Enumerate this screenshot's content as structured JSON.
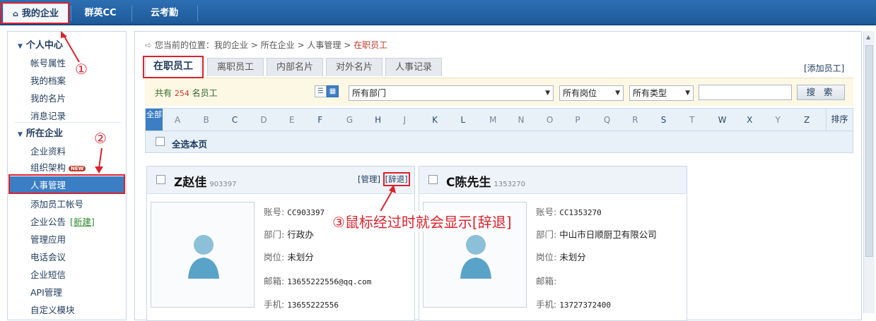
{
  "topnav": {
    "tabs": [
      "我的企业",
      "群英CC",
      "云考勤"
    ]
  },
  "sidebar": {
    "sections": [
      {
        "title": "个人中心",
        "items": [
          "帐号属性",
          "我的档案",
          "我的名片",
          "消息记录"
        ]
      },
      {
        "title": "所在企业",
        "items": [
          "企业资料",
          "组织架构",
          "人事管理",
          "添加员工帐号",
          "企业公告",
          "管理应用",
          "电话会议",
          "企业短信",
          "API管理",
          "自定义模块"
        ]
      }
    ],
    "new_badge": "NEW",
    "new_link": "[新建]"
  },
  "breadcrumb": {
    "prefix": "您当前的位置：",
    "items": [
      "我的企业",
      "所在企业",
      "人事管理"
    ],
    "current": "在职员工",
    "sep": ">"
  },
  "subtabs": [
    "在职员工",
    "离职员工",
    "内部名片",
    "对外名片",
    "人事记录"
  ],
  "add_employee": "[添加员工]",
  "filters": {
    "count_prefix": "共有",
    "count": "254",
    "count_suffix": "名员工",
    "department": "所有部门",
    "position": "所有岗位",
    "type": "所有类型",
    "search_value": "",
    "search_button": "搜 索"
  },
  "alphabet": {
    "all": "全部",
    "letters": [
      "A",
      "B",
      "C",
      "D",
      "E",
      "F",
      "G",
      "H",
      "J",
      "K",
      "L",
      "M",
      "N",
      "O",
      "P",
      "Q",
      "R",
      "S",
      "T",
      "W",
      "X",
      "Y",
      "Z"
    ],
    "sort": "排序"
  },
  "select_all": "全选本页",
  "labels": {
    "account": "账号:",
    "department": "部门:",
    "position": "岗位:",
    "email": "邮箱:",
    "mobile": "手机:",
    "manage": "[管理]",
    "fire": "[辞退]"
  },
  "employees": [
    {
      "name": "Z赵佳",
      "id": "903397",
      "account": "CC903397",
      "department": "行政办",
      "position": "未划分",
      "email": "13655222556@qq.com",
      "mobile": "13655222556"
    },
    {
      "name": "C陈先生",
      "id": "1353270",
      "account": "CC1353270",
      "department": "中山市日顺厨卫有限公司",
      "position": "未划分",
      "email": "",
      "mobile": "13727372400"
    }
  ],
  "annotations": {
    "n1": "①",
    "n2": "②",
    "n3_text": "③鼠标经过时就会显示[辞退]"
  },
  "colors": {
    "accent": "#2d6fb3",
    "annotation": "#d9232d",
    "active_side": "#3c7ec4"
  }
}
